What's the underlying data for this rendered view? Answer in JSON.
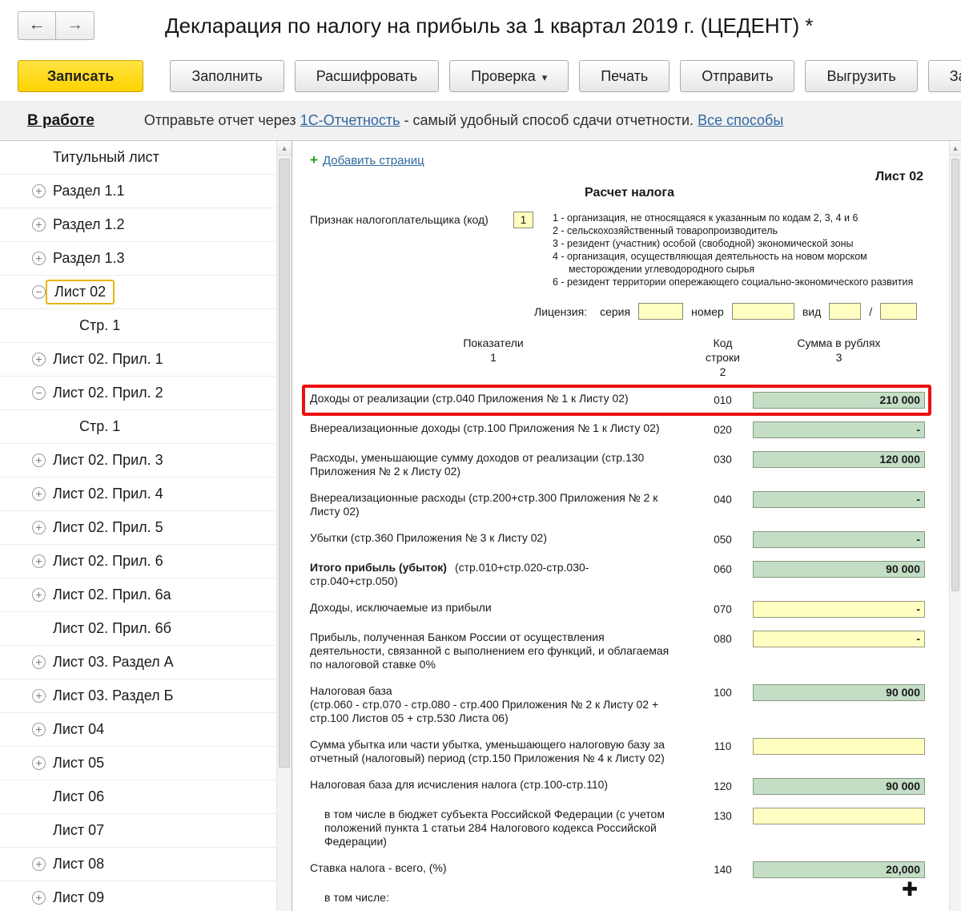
{
  "icons": {
    "back": "←",
    "forward": "→",
    "caret_down": "▾",
    "plus": "+",
    "scroll_up": "▲",
    "expand_plus": "+",
    "expand_minus": "−",
    "cursor": "✚"
  },
  "window": {
    "title": "Декларация по налогу на прибыль за 1 квартал 2019 г. (ЦЕДЕНТ) *"
  },
  "toolbar": {
    "save": "Записать",
    "fill": "Заполнить",
    "decipher": "Расшифровать",
    "check": "Проверка",
    "print": "Печать",
    "send": "Отправить",
    "export": "Выгрузить",
    "truncated": "Зап"
  },
  "status": {
    "state": "В работе",
    "hint_prefix": "Отправьте отчет через ",
    "hint_link1": "1С-Отчетность",
    "hint_middle": " - самый удобный способ сдачи отчетности. ",
    "hint_link2": "Все способы"
  },
  "sidebar": {
    "items": [
      {
        "label": "Титульный лист",
        "icon": "none"
      },
      {
        "label": "Раздел 1.1",
        "icon": "plus"
      },
      {
        "label": "Раздел 1.2",
        "icon": "plus"
      },
      {
        "label": "Раздел 1.3",
        "icon": "plus"
      },
      {
        "label": "Лист 02",
        "icon": "minus",
        "selected": true
      },
      {
        "label": "Стр. 1",
        "icon": "none",
        "indent": true
      },
      {
        "label": "Лист 02. Прил. 1",
        "icon": "plus"
      },
      {
        "label": "Лист 02. Прил. 2",
        "icon": "minus"
      },
      {
        "label": "Стр. 1",
        "icon": "none",
        "indent": true
      },
      {
        "label": "Лист 02. Прил. 3",
        "icon": "plus"
      },
      {
        "label": "Лист 02. Прил. 4",
        "icon": "plus"
      },
      {
        "label": "Лист 02. Прил. 5",
        "icon": "plus"
      },
      {
        "label": "Лист 02. Прил. 6",
        "icon": "plus"
      },
      {
        "label": "Лист 02. Прил. 6а",
        "icon": "plus"
      },
      {
        "label": "Лист 02. Прил. 6б",
        "icon": "none"
      },
      {
        "label": "Лист 03. Раздел А",
        "icon": "plus"
      },
      {
        "label": "Лист 03. Раздел Б",
        "icon": "plus"
      },
      {
        "label": "Лист 04",
        "icon": "plus"
      },
      {
        "label": "Лист 05",
        "icon": "plus"
      },
      {
        "label": "Лист 06",
        "icon": "none"
      },
      {
        "label": "Лист 07",
        "icon": "none"
      },
      {
        "label": "Лист 08",
        "icon": "plus"
      },
      {
        "label": "Лист 09",
        "icon": "plus"
      }
    ]
  },
  "main": {
    "add_pages": "Добавить страниц",
    "sheet_label": "Лист 02",
    "section_title": "Расчет налога",
    "taxpayer": {
      "label": "Признак налогоплательщика (код)",
      "value": "1",
      "legend": [
        "1 - организация, не относящаяся к указанным по кодам 2, 3, 4 и 6",
        "2 - сельскохозяйственный товаропроизводитель",
        "3 - резидент (участник) особой (свободной) экономической зоны",
        "4 - организация, осуществляющая деятельность на новом морском месторождении углеводородного сырья",
        "6 - резидент территории опережающего социально-экономического развития"
      ]
    },
    "license": {
      "label": "Лицензия:",
      "series_label": "серия",
      "series_value": "",
      "number_label": "номер",
      "number_value": "",
      "kind_label": "вид",
      "kind_value": "",
      "slash": "/",
      "kind2_value": ""
    },
    "columns": [
      {
        "title": "Показатели",
        "num": "1"
      },
      {
        "title": "Код строки",
        "num": "2"
      },
      {
        "title": "Сумма в рублях",
        "num": "3"
      }
    ],
    "rows": [
      {
        "label": "Доходы от реализации (стр.040 Приложения № 1 к Листу 02)",
        "code": "010",
        "value": "210 000",
        "field": "green",
        "highlight": true
      },
      {
        "label": "Внереализационные доходы (стр.100 Приложения № 1 к Листу 02)",
        "code": "020",
        "value": "-",
        "field": "green"
      },
      {
        "label": "Расходы, уменьшающие сумму доходов от реализации (стр.130 Приложения № 2 к Листу 02)",
        "code": "030",
        "value": "120 000",
        "field": "green"
      },
      {
        "label": "Внереализационные расходы (стр.200+стр.300 Приложения № 2 к Листу 02)",
        "code": "040",
        "value": "-",
        "field": "green"
      },
      {
        "label": "Убытки (стр.360 Приложения № 3 к Листу 02)",
        "code": "050",
        "value": "-",
        "field": "green"
      },
      {
        "label_bold": "Итого прибыль (убыток)",
        "label": "(стр.010+стр.020-стр.030-стр.040+стр.050)",
        "code": "060",
        "value": "90 000",
        "field": "green"
      },
      {
        "label": "Доходы, исключаемые из прибыли",
        "code": "070",
        "value": "-",
        "field": "yellow"
      },
      {
        "label": "Прибыль, полученная Банком России от осуществления деятельности, связанной с выполнением его функций, и облагаемая по налоговой ставке 0%",
        "code": "080",
        "value": "-",
        "field": "yellow"
      },
      {
        "label": "Налоговая база\n(стр.060 - стр.070 - стр.080 - стр.400 Приложения № 2 к Листу 02 +\nстр.100 Листов 05 + стр.530 Листа 06)",
        "code": "100",
        "value": "90 000",
        "field": "green"
      },
      {
        "label": "Сумма убытка или части убытка, уменьшающего налоговую базу за отчетный (налоговый) период (стр.150 Приложения № 4 к Листу 02)",
        "code": "110",
        "value": "",
        "field": "yellow"
      },
      {
        "label": "Налоговая база для исчисления налога (стр.100-стр.110)",
        "code": "120",
        "value": "90 000",
        "field": "green"
      },
      {
        "label": "в том числе в бюджет субъекта Российской Федерации (с учетом положений пункта 1 статьи 284 Налогового кодекса Российской Федерации)",
        "code": "130",
        "value": "",
        "field": "yellow",
        "indent": true
      },
      {
        "label": "Ставка налога - всего, (%)",
        "code": "140",
        "value": "20,000",
        "field": "green"
      },
      {
        "label": "в том числе:",
        "code": "",
        "value": "",
        "field": "none",
        "indent": true
      }
    ]
  }
}
